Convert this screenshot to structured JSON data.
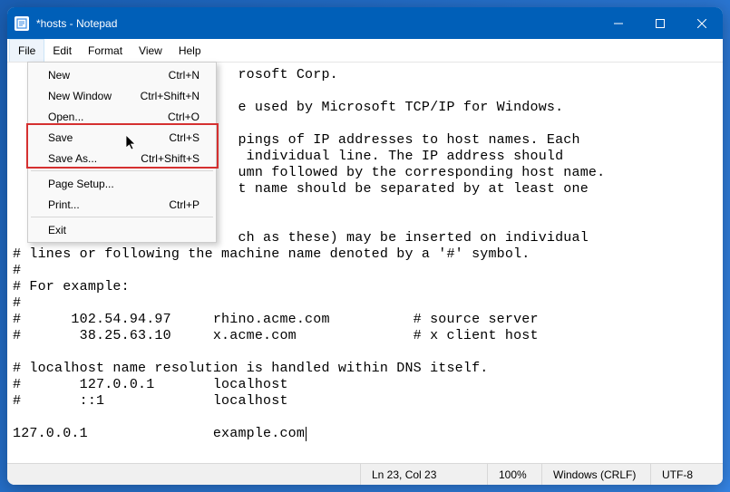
{
  "window": {
    "title": "*hosts - Notepad"
  },
  "menubar": [
    "File",
    "Edit",
    "Format",
    "View",
    "Help"
  ],
  "file_menu": {
    "items": [
      {
        "label": "New",
        "shortcut": "Ctrl+N"
      },
      {
        "label": "New Window",
        "shortcut": "Ctrl+Shift+N"
      },
      {
        "label": "Open...",
        "shortcut": "Ctrl+O"
      },
      {
        "label": "Save",
        "shortcut": "Ctrl+S"
      },
      {
        "label": "Save As...",
        "shortcut": "Ctrl+Shift+S"
      },
      {
        "label": "Page Setup...",
        "shortcut": ""
      },
      {
        "label": "Print...",
        "shortcut": "Ctrl+P"
      },
      {
        "label": "Exit",
        "shortcut": ""
      }
    ]
  },
  "editor": {
    "lines": [
      "rosoft Corp.",
      "",
      "e used by Microsoft TCP/IP for Windows.",
      "",
      "pings of IP addresses to host names. Each",
      " individual line. The IP address should",
      "umn followed by the corresponding host name.",
      "t name should be separated by at least one",
      "",
      "",
      "ch as these) may be inserted on individual",
      "# lines or following the machine name denoted by a '#' symbol.",
      "#",
      "# For example:",
      "#",
      "#      102.54.94.97     rhino.acme.com          # source server",
      "#       38.25.63.10     x.acme.com              # x client host",
      "",
      "# localhost name resolution is handled within DNS itself.",
      "#       127.0.0.1       localhost",
      "#       ::1             localhost",
      "",
      "127.0.0.1               example.com"
    ],
    "obscured_indent": "                           "
  },
  "statusbar": {
    "position": "Ln 23, Col 23",
    "zoom": "100%",
    "line_ending": "Windows (CRLF)",
    "encoding": "UTF-8"
  }
}
